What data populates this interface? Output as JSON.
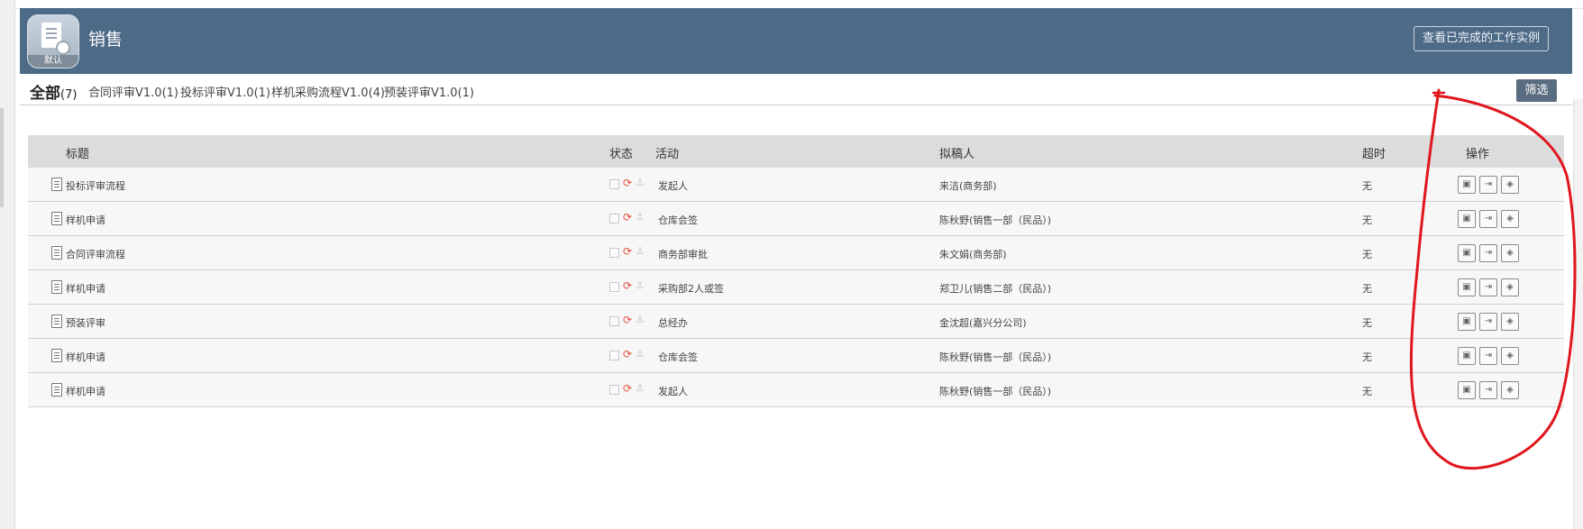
{
  "header": {
    "app_badge": "默认",
    "title": "销售",
    "completed_button": "查看已完成的工作实例"
  },
  "tabs": {
    "all_label": "全部",
    "all_count": "(7)",
    "items": [
      "合同评审V1.0(1)",
      "投标评审V1.0(1)",
      "样机采购流程V1.0(4)",
      "预装评审V1.0(1)"
    ],
    "filter_button": "筛选"
  },
  "table": {
    "headers": {
      "title": "标题",
      "status": "状态",
      "activity": "活动",
      "drafter": "拟稿人",
      "timeout": "超时",
      "actions": "操作"
    },
    "rows": [
      {
        "title": "投标评审流程",
        "activity": "发起人",
        "drafter": "来洁(商务部)",
        "timeout": "无"
      },
      {
        "title": "样机申请",
        "activity": "仓库会签",
        "drafter": "陈秋野(销售一部（民品）)",
        "timeout": "无"
      },
      {
        "title": "合同评审流程",
        "activity": "商务部审批",
        "drafter": "朱文娟(商务部)",
        "timeout": "无"
      },
      {
        "title": "样机申请",
        "activity": "采购部2人或签",
        "drafter": "郑卫儿(销售二部（民品）)",
        "timeout": "无"
      },
      {
        "title": "预装评审",
        "activity": "总经办",
        "drafter": "金沈超(嘉兴分公司)",
        "timeout": "无"
      },
      {
        "title": "样机申请",
        "activity": "仓库会签",
        "drafter": "陈秋野(销售一部（民品）)",
        "timeout": "无"
      },
      {
        "title": "样机申请",
        "activity": "发起人",
        "drafter": "陈秋野(销售一部（民品）)",
        "timeout": "无"
      }
    ]
  },
  "icons": {
    "status": [
      "checkbox-icon",
      "sync-icon",
      "anchor-icon"
    ],
    "actions": [
      "open-icon",
      "exit-icon",
      "flow-icon"
    ]
  },
  "colors": {
    "header_bg": "#4d6a87",
    "filter_bg": "#5a6c7f",
    "table_header_bg": "#dcdcdc",
    "sync_red": "#e0503a",
    "annotation_red": "#e0161d"
  }
}
